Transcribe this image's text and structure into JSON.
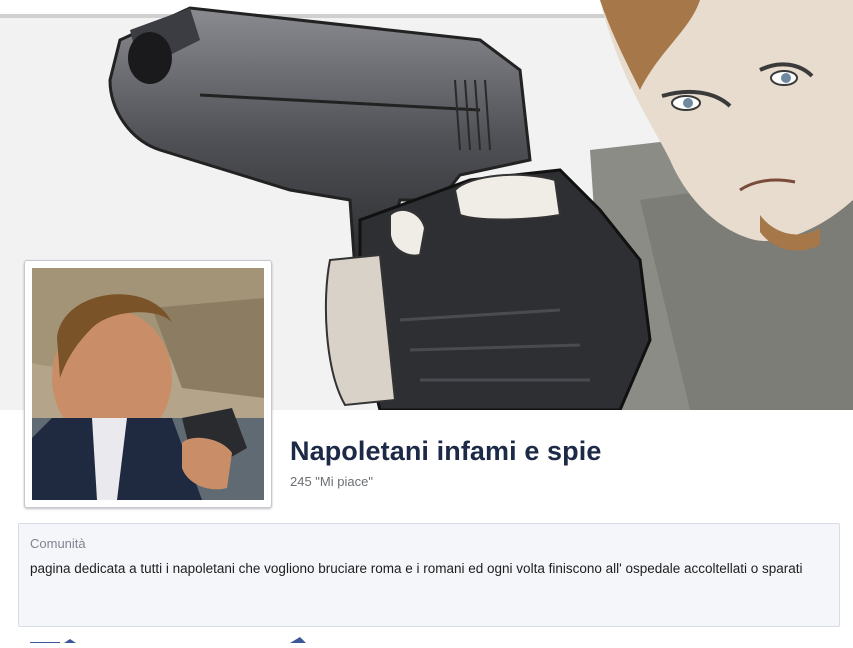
{
  "page": {
    "name": "Napoletani infami e spie",
    "likes": "245 \"Mi piace\""
  },
  "about": {
    "category": "Comunità",
    "description": "pagina dedicata a tutti i napoletani che vogliono bruciare roma e i romani ed ogni volta finiscono all' ospedale accoltellati o sparati"
  }
}
